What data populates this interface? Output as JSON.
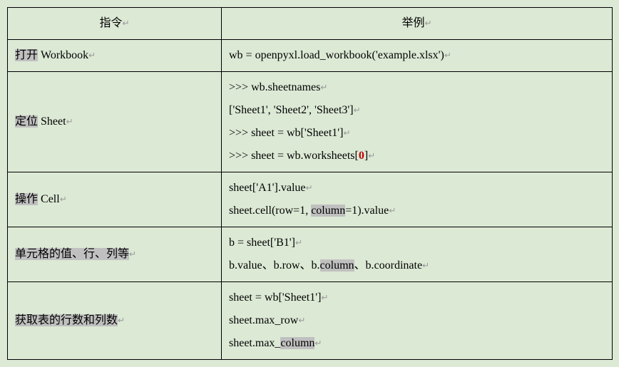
{
  "header": {
    "col1": "指令",
    "col2": "举例"
  },
  "rows": [
    {
      "cmd": [
        {
          "segs": [
            {
              "t": "打开",
              "hl": true
            },
            {
              "t": " Workbook"
            }
          ]
        }
      ],
      "ex": [
        {
          "segs": [
            {
              "t": "wb = openpyxl.load_workbook('example.xlsx')"
            }
          ]
        }
      ]
    },
    {
      "cmd": [
        {
          "segs": [
            {
              "t": "定位",
              "hl": true
            },
            {
              "t": " Sheet"
            }
          ]
        }
      ],
      "ex": [
        {
          "segs": [
            {
              "t": ">>> wb.sheetnames"
            }
          ]
        },
        {
          "segs": [
            {
              "t": "['Sheet1', 'Sheet2', 'Sheet3']"
            }
          ]
        },
        {
          "segs": [
            {
              "t": ">>> sheet = wb['Sheet1']"
            }
          ]
        },
        {
          "segs": [
            {
              "t": ">>> sheet = wb.worksheets["
            },
            {
              "t": "0",
              "red": true
            },
            {
              "t": "]"
            }
          ]
        }
      ]
    },
    {
      "cmd": [
        {
          "segs": [
            {
              "t": "操作",
              "hl": true
            },
            {
              "t": " Cell"
            }
          ]
        }
      ],
      "ex": [
        {
          "segs": [
            {
              "t": "sheet['A1'].value"
            }
          ]
        },
        {
          "segs": [
            {
              "t": "sheet.cell(row=1, "
            },
            {
              "t": "column",
              "hl": true
            },
            {
              "t": "=1).value"
            }
          ]
        }
      ]
    },
    {
      "cmd": [
        {
          "segs": [
            {
              "t": "单元格的值、行、列等",
              "hl": true
            }
          ]
        }
      ],
      "ex": [
        {
          "segs": [
            {
              "t": "b = sheet['B1']"
            }
          ]
        },
        {
          "segs": [
            {
              "t": "b.value、b.row、b."
            },
            {
              "t": "column",
              "hl": true
            },
            {
              "t": "、b.coordinate"
            }
          ]
        }
      ]
    },
    {
      "cmd": [
        {
          "segs": [
            {
              "t": "获取表的行数和列数",
              "hl": true
            }
          ]
        }
      ],
      "ex": [
        {
          "segs": [
            {
              "t": "sheet = wb['Sheet1']"
            }
          ]
        },
        {
          "segs": [
            {
              "t": "sheet.max_row"
            }
          ]
        },
        {
          "segs": [
            {
              "t": "sheet.max_"
            },
            {
              "t": "column",
              "hl": true
            }
          ]
        }
      ]
    }
  ],
  "return_glyph": "↵"
}
